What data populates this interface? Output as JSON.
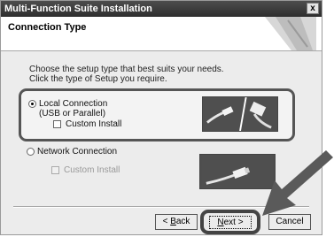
{
  "window": {
    "title": "Multi-Function Suite Installation",
    "close_label": "x"
  },
  "header": {
    "title": "Connection Type"
  },
  "prompt": {
    "line1": "Choose the setup type that best suits your needs.",
    "line2": "Click the type of Setup you require."
  },
  "options": {
    "local": {
      "label_line1": "Local Connection",
      "label_line2": "(USB or Parallel)",
      "selected": true,
      "custom_install": "Custom Install",
      "image_icon": "usb-parallel-cable-icon"
    },
    "network": {
      "label": "Network Connection",
      "selected": false,
      "custom_install": "Custom Install",
      "custom_install_disabled": true,
      "image_icon": "network-cable-icon"
    }
  },
  "buttons": {
    "back": {
      "lt": "< ",
      "accel": "B",
      "rest": "ack"
    },
    "next": {
      "accel": "N",
      "rest": "ext >"
    },
    "cancel": "Cancel"
  },
  "colors": {
    "titlebar": "#3a3a3a",
    "highlight_ring": "#444444",
    "pointer_arrow": "#5a5a5a"
  }
}
